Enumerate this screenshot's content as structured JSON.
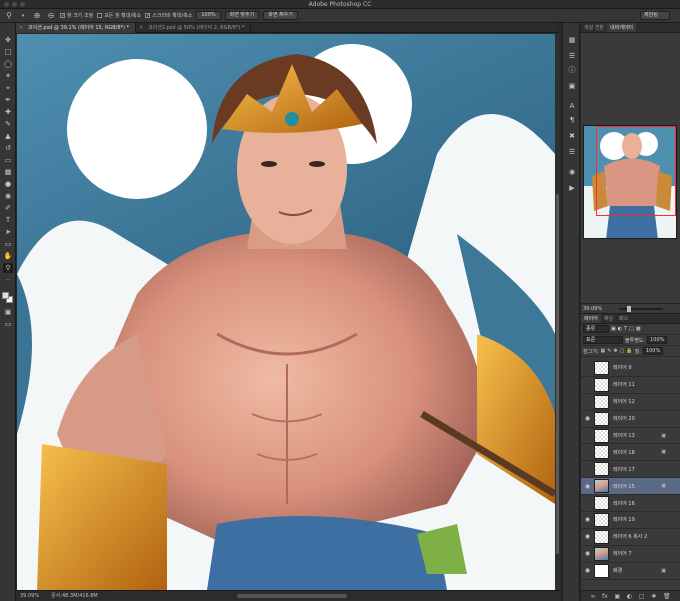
{
  "window": {
    "title": "Adobe Photoshop CC"
  },
  "options_bar": {
    "checkbox_1": "창 크기 조정",
    "checkbox_2": "모든 창 확대/축소",
    "checkbox_3": "스크러비 확대/축소",
    "zoom_button": "100%",
    "fit_button": "화면 맞추기",
    "fill_button": "화면 채우기",
    "workspace": "제임팅"
  },
  "tabs": [
    {
      "label": "코이션.psd @ 39.1% (레이어 15, RGB/8*) *"
    },
    {
      "label": "코이션2.psd @ 50% (레이어 2, RGB/8*) *"
    }
  ],
  "status": {
    "zoom": "39.09%",
    "doc": "문서:48.3M/416.8M"
  },
  "nav_panel": {
    "tab_histogram": "색상 견본",
    "tab_navigator": "내비게이터",
    "zoom": "39.09%"
  },
  "layers_panel": {
    "tabs": [
      "레이어",
      "채널",
      "패스"
    ],
    "kind_filter": "종류",
    "blend_mode": "표준",
    "opacity_label": "불투명도:",
    "opacity": "100%",
    "lock_label": "잠그기:",
    "fill_label": "칠:",
    "fill": "100%",
    "layers": [
      {
        "name": "레이어 9",
        "visible": false,
        "locked": false,
        "thumb": "checker"
      },
      {
        "name": "레이어 11",
        "visible": false,
        "locked": false,
        "thumb": "checker"
      },
      {
        "name": "레이어 12",
        "visible": false,
        "locked": false,
        "thumb": "checker"
      },
      {
        "name": "레이어 20",
        "visible": true,
        "locked": false,
        "thumb": "checker"
      },
      {
        "name": "레이어 13",
        "visible": false,
        "locked": true,
        "thumb": "checker"
      },
      {
        "name": "레이어 18",
        "visible": false,
        "locked": true,
        "thumb": "checker"
      },
      {
        "name": "레이어 17",
        "visible": false,
        "locked": false,
        "thumb": "checker"
      },
      {
        "name": "레이어 15",
        "visible": true,
        "locked": true,
        "thumb": "image",
        "selected": true
      },
      {
        "name": "레이어 16",
        "visible": false,
        "locked": false,
        "thumb": "checker"
      },
      {
        "name": "레이어 19",
        "visible": true,
        "locked": false,
        "thumb": "checker"
      },
      {
        "name": "레이어 6 복사 2",
        "visible": true,
        "locked": false,
        "thumb": "checker"
      },
      {
        "name": "레이어 7",
        "visible": true,
        "locked": false,
        "thumb": "image"
      },
      {
        "name": "배경",
        "visible": true,
        "locked": true,
        "thumb": "white"
      }
    ]
  },
  "colors": {
    "foreground": "#cfe6ee",
    "background": "#ffffff",
    "selection": "#5a6a85"
  }
}
